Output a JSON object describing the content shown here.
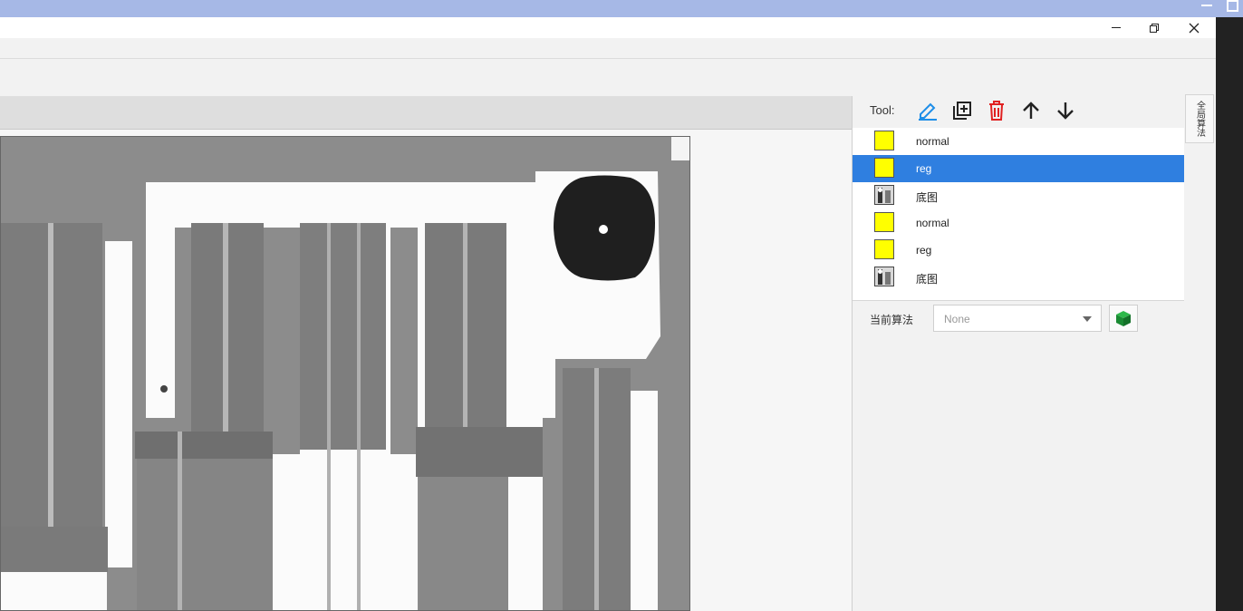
{
  "window": {
    "minimize_icon": "minimize-icon",
    "restore_icon": "restore-icon",
    "close_icon": "close-icon"
  },
  "tools": {
    "label": "Tool:",
    "buttons": [
      {
        "name": "edit",
        "icon": "pencil-icon",
        "color": "#1e8ee8"
      },
      {
        "name": "add",
        "icon": "add-layer-icon",
        "color": "#222222"
      },
      {
        "name": "delete",
        "icon": "trash-icon",
        "color": "#e02020"
      },
      {
        "name": "move-up",
        "icon": "arrow-up-icon",
        "color": "#222222"
      },
      {
        "name": "move-down",
        "icon": "arrow-down-icon",
        "color": "#222222"
      }
    ]
  },
  "layers": [
    {
      "label": "normal",
      "type": "color",
      "color": "#ffff00",
      "selected": false
    },
    {
      "label": "reg",
      "type": "color",
      "color": "#ffff00",
      "selected": true
    },
    {
      "label": "底图",
      "type": "image",
      "selected": false
    },
    {
      "label": "normal",
      "type": "color",
      "color": "#ffff00",
      "selected": false
    },
    {
      "label": "reg",
      "type": "color",
      "color": "#ffff00",
      "selected": false
    },
    {
      "label": "底图",
      "type": "image",
      "selected": false
    }
  ],
  "algorithm": {
    "label": "当前算法",
    "selected": "None",
    "cube_icon": "cube-icon"
  },
  "side_tab": {
    "label": "全局算法"
  },
  "colors": {
    "selection": "#2f7fe0",
    "title_accent": "#a6b8e6"
  }
}
